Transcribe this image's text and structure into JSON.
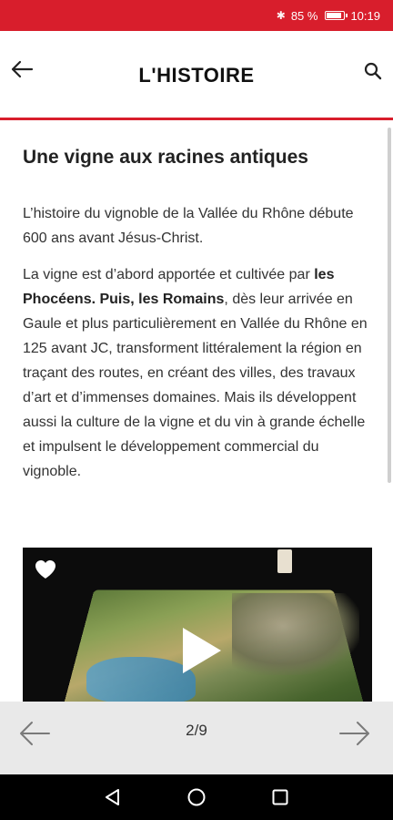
{
  "status_bar": {
    "bluetooth_icon": "bluetooth-icon",
    "battery_text": "85 %",
    "battery_level": 0.85,
    "time": "10:19",
    "color": "#d81e2c"
  },
  "header": {
    "title": "L'HISTOIRE",
    "back_icon": "arrow-left-icon",
    "search_icon": "search-icon",
    "accent": "#d81e2c"
  },
  "article": {
    "title": "Une vigne aux racines antiques",
    "paragraph1": "L’histoire du vignoble de la Vallée du Rhône débute 600 ans avant Jésus-Christ.",
    "paragraph2_start": "La vigne est d’abord apportée et cultivée par ",
    "paragraph2_bold": "les Phocéens. Puis, les Romains",
    "paragraph2_end": ", dès leur arrivée en Gaule et plus particulièrement en Vallée du Rhône en 125 avant JC, transforment littéralement la région en traçant des routes, en créant des villes, des travaux d’art et d’immenses domaines. Mais ils développent aussi la culture de la vigne et du vin à grande échelle et impulsent le développement commercial du vignoble."
  },
  "video": {
    "favorite_icon": "heart-icon",
    "play_icon": "play-icon"
  },
  "pager": {
    "current": "2/9",
    "prev_icon": "arrow-left-icon",
    "next_icon": "arrow-right-icon"
  },
  "system_nav": {
    "back_icon": "triangle-back-icon",
    "home_icon": "circle-home-icon",
    "recent_icon": "square-recent-icon"
  }
}
